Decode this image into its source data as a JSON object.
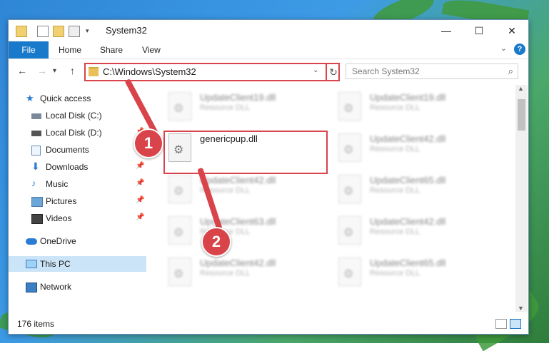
{
  "window": {
    "title": "System32"
  },
  "ribbon": {
    "file": "File",
    "home": "Home",
    "share": "Share",
    "view": "View",
    "help": "?"
  },
  "address": {
    "path": "C:\\Windows\\System32"
  },
  "search": {
    "placeholder": "Search System32"
  },
  "sidebar": {
    "items": [
      {
        "label": "Quick access",
        "icon": "star-icon"
      },
      {
        "label": "Local Disk (C:)",
        "icon": "drive-icon"
      },
      {
        "label": "Local Disk (D:)",
        "icon": "drive-icon"
      },
      {
        "label": "Documents",
        "icon": "documents-icon"
      },
      {
        "label": "Downloads",
        "icon": "download-icon"
      },
      {
        "label": "Music",
        "icon": "music-icon"
      },
      {
        "label": "Pictures",
        "icon": "pictures-icon"
      },
      {
        "label": "Videos",
        "icon": "videos-icon"
      },
      {
        "label": "OneDrive",
        "icon": "cloud-icon"
      },
      {
        "label": "This PC",
        "icon": "pc-icon"
      },
      {
        "label": "Network",
        "icon": "network-icon"
      }
    ]
  },
  "files": [
    {
      "name": "UpdateClient19.dll",
      "desc": "Resource DLL"
    },
    {
      "name": "UpdateClient19.dll",
      "desc": "Resource DLL"
    },
    {
      "name": "genericpup.dll",
      "desc": ""
    },
    {
      "name": "UpdateClient42.dll",
      "desc": "Resource DLL"
    },
    {
      "name": "UpdateClient42.dll",
      "desc": "Resource DLL"
    },
    {
      "name": "UpdateClient65.dll",
      "desc": "Resource DLL"
    },
    {
      "name": "UpdateClient63.dll",
      "desc": "Resource DLL"
    },
    {
      "name": "UpdateClient42.dll",
      "desc": "Resource DLL"
    },
    {
      "name": "UpdateClient42.dll",
      "desc": "Resource DLL"
    },
    {
      "name": "UpdateClient65.dll",
      "desc": "Resource DLL"
    }
  ],
  "status": {
    "count": "176 items"
  },
  "annotations": {
    "step1": "1",
    "step2": "2"
  },
  "colors": {
    "accent": "#1979ca",
    "highlight": "#d9434a",
    "selected": "#cce4f7"
  }
}
